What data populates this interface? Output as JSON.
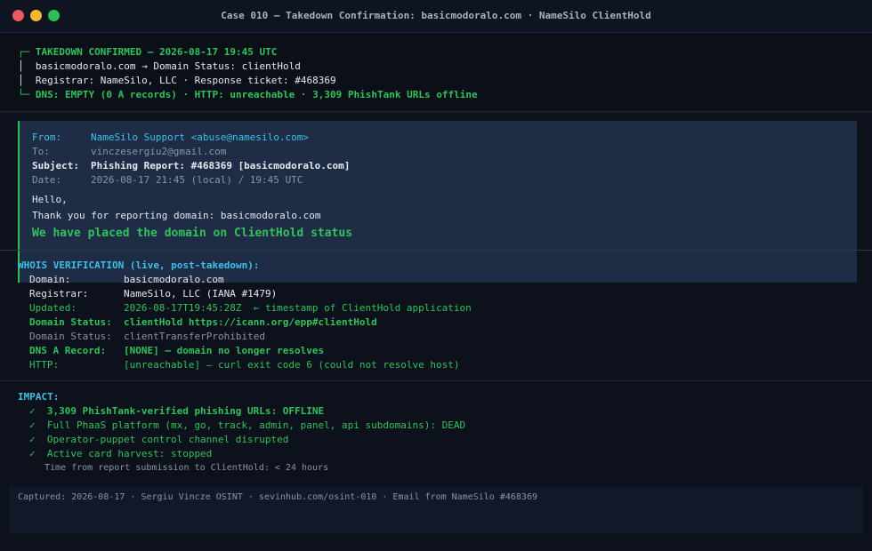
{
  "window": {
    "title": "Case 010 — Takedown Confirmation: basicmodoralo.com · NameSilo ClientHold"
  },
  "banner": {
    "line1_prefix": "┌─",
    "line1": "TAKEDOWN CONFIRMED — 2026-08-17 19:45 UTC",
    "line2_prefix": "│",
    "line2": "basicmodoralo.com → Domain Status: clientHold",
    "line3_prefix": "│",
    "line3": "Registrar: NameSilo, LLC · Response ticket: #468369",
    "line4_prefix": "└─",
    "line4": "DNS: EMPTY (0 A records) · HTTP: unreachable · 3,309 PhishTank URLs offline"
  },
  "email": {
    "from_label": "From:",
    "from_value": "NameSilo Support <abuse@namesilo.com>",
    "to_label": "To:",
    "to_value": "vinczesergiu2@gmail.com",
    "subject_label": "Subject:",
    "subject_value": "Phishing Report: #468369 [basicmodoralo.com]",
    "date_label": "Date:",
    "date_value": "2026-08-17 21:45 (local) / 19:45 UTC",
    "greeting": "Hello,",
    "body_line": "Thank you for reporting domain: basicmodoralo.com",
    "headline": "We have placed the domain on ClientHold status"
  },
  "whois": {
    "heading": "WHOIS VERIFICATION (live, post-takedown):",
    "rows": [
      {
        "label": "Domain:",
        "value": "basicmodoralo.com"
      },
      {
        "label": "Registrar:",
        "value": "NameSilo, LLC (IANA #1479)"
      },
      {
        "label": "Updated:",
        "value": "2026-08-17T19:45:28Z  ← timestamp of ClientHold application"
      },
      {
        "label": "Domain Status:",
        "value": "clientHold https://icann.org/epp#clientHold"
      },
      {
        "label": "Domain Status:",
        "value": "clientTransferProhibited"
      },
      {
        "label": "DNS A Record:",
        "value": "[NONE] — domain no longer resolves"
      },
      {
        "label": "HTTP:",
        "value": "[unreachable] — curl exit code 6 (could not resolve host)"
      }
    ]
  },
  "impact": {
    "heading": "IMPACT:",
    "check": "✓",
    "items": [
      "3,309 PhishTank-verified phishing URLs: OFFLINE",
      "Full PhaaS platform (mx, go, track, admin, panel, api subdomains): DEAD",
      "Operator-puppet control channel disrupted",
      "Active card harvest: stopped"
    ],
    "note": "Time from report submission to ClientHold: < 24 hours"
  },
  "footer": {
    "caption": "Captured: 2026-08-17 · Sergiu Vincze OSINT · sevinhub.com/osint-010 · Email from NameSilo #468369"
  },
  "colors": {
    "background": "#0c111b",
    "accent_green": "#34c15b",
    "accent_cyan": "#3ec1e8",
    "email_panel": "#1e2c45"
  }
}
